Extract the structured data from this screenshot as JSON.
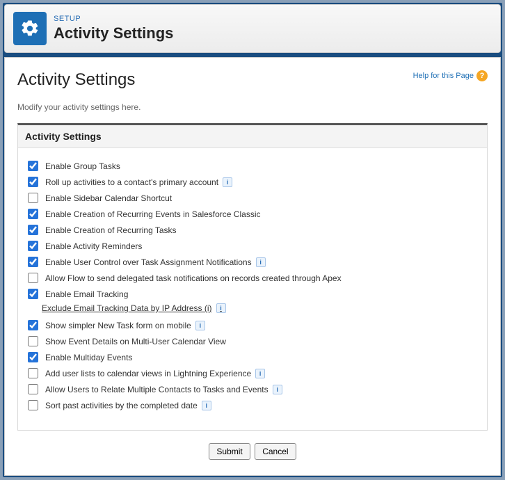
{
  "header": {
    "setup_label": "SETUP",
    "title": "Activity Settings"
  },
  "page": {
    "title": "Activity Settings",
    "help_text": "Help for this Page",
    "subtitle": "Modify your activity settings here.",
    "section_heading": "Activity Settings"
  },
  "settings": [
    {
      "label": "Enable Group Tasks",
      "checked": true,
      "info": false
    },
    {
      "label": "Roll up activities to a contact's primary account",
      "checked": true,
      "info": true
    },
    {
      "label": "Enable Sidebar Calendar Shortcut",
      "checked": false,
      "info": false
    },
    {
      "label": "Enable Creation of Recurring Events in Salesforce Classic",
      "checked": true,
      "info": false
    },
    {
      "label": "Enable Creation of Recurring Tasks",
      "checked": true,
      "info": false
    },
    {
      "label": "Enable Activity Reminders",
      "checked": true,
      "info": false
    },
    {
      "label": "Enable User Control over Task Assignment Notifications",
      "checked": true,
      "info": true
    },
    {
      "label": "Allow Flow to send delegated task notifications on records created through Apex",
      "checked": false,
      "info": false
    },
    {
      "label": "Enable Email Tracking",
      "checked": true,
      "info": false
    },
    {
      "label": "Show simpler New Task form on mobile",
      "checked": true,
      "info": true
    },
    {
      "label": "Show Event Details on Multi-User Calendar View",
      "checked": false,
      "info": false
    },
    {
      "label": "Enable Multiday Events",
      "checked": true,
      "info": false
    },
    {
      "label": "Add user lists to calendar views in Lightning Experience",
      "checked": false,
      "info": true
    },
    {
      "label": "Allow Users to Relate Multiple Contacts to Tasks and Events",
      "checked": false,
      "info": true
    },
    {
      "label": "Sort past activities by the completed date",
      "checked": false,
      "info": true
    }
  ],
  "sublink": {
    "after_index": 8,
    "text": "Exclude Email Tracking Data by IP Address (i)",
    "info": true
  },
  "buttons": {
    "submit": "Submit",
    "cancel": "Cancel"
  }
}
